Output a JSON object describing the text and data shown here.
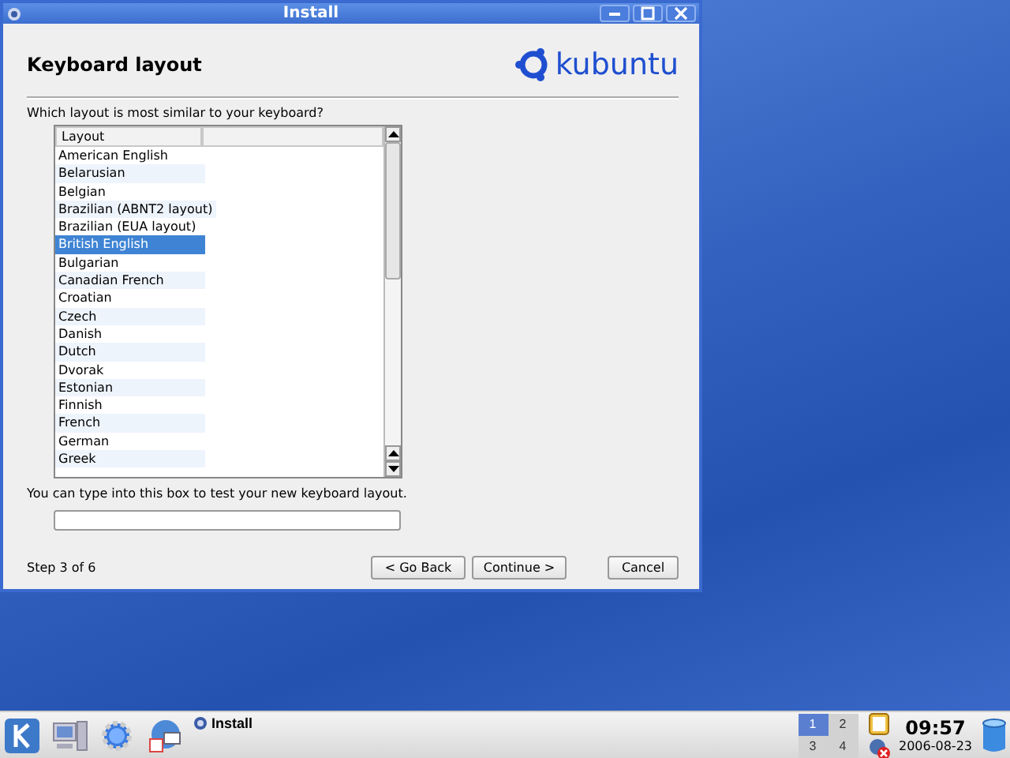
{
  "window": {
    "title": "Install"
  },
  "header": {
    "title": "Keyboard layout",
    "logo_text": "kubuntu"
  },
  "prompt": "Which layout is most similar to your keyboard?",
  "layout_list": {
    "columns": [
      "Layout"
    ],
    "rows": [
      {
        "label": "American English",
        "selected": false
      },
      {
        "label": "Belarusian",
        "selected": false
      },
      {
        "label": "Belgian",
        "selected": false
      },
      {
        "label": "Brazilian (ABNT2 layout)",
        "selected": false
      },
      {
        "label": "Brazilian (EUA layout)",
        "selected": false
      },
      {
        "label": "British English",
        "selected": true
      },
      {
        "label": "Bulgarian",
        "selected": false
      },
      {
        "label": "Canadian French",
        "selected": false
      },
      {
        "label": "Croatian",
        "selected": false
      },
      {
        "label": "Czech",
        "selected": false
      },
      {
        "label": "Danish",
        "selected": false
      },
      {
        "label": "Dutch",
        "selected": false
      },
      {
        "label": "Dvorak",
        "selected": false
      },
      {
        "label": "Estonian",
        "selected": false
      },
      {
        "label": "Finnish",
        "selected": false
      },
      {
        "label": "French",
        "selected": false
      },
      {
        "label": "German",
        "selected": false
      },
      {
        "label": "Greek",
        "selected": false
      }
    ]
  },
  "test_prompt": "You can type into this box to test your new keyboard layout.",
  "step": "Step 3 of 6",
  "buttons": [
    {
      "label": "< Go Back",
      "kind": "nav"
    },
    {
      "label": "Continue >",
      "kind": "nav"
    },
    {
      "label": "Cancel",
      "kind": "cancel"
    }
  ],
  "taskbar": {
    "task": "Install",
    "pager": [
      {
        "label": "1",
        "selected": true
      },
      {
        "label": "2",
        "selected": false
      },
      {
        "label": "3",
        "selected": false
      },
      {
        "label": "4",
        "selected": false
      }
    ],
    "clock": {
      "time": "09:57",
      "date": "2006-08-23"
    }
  }
}
